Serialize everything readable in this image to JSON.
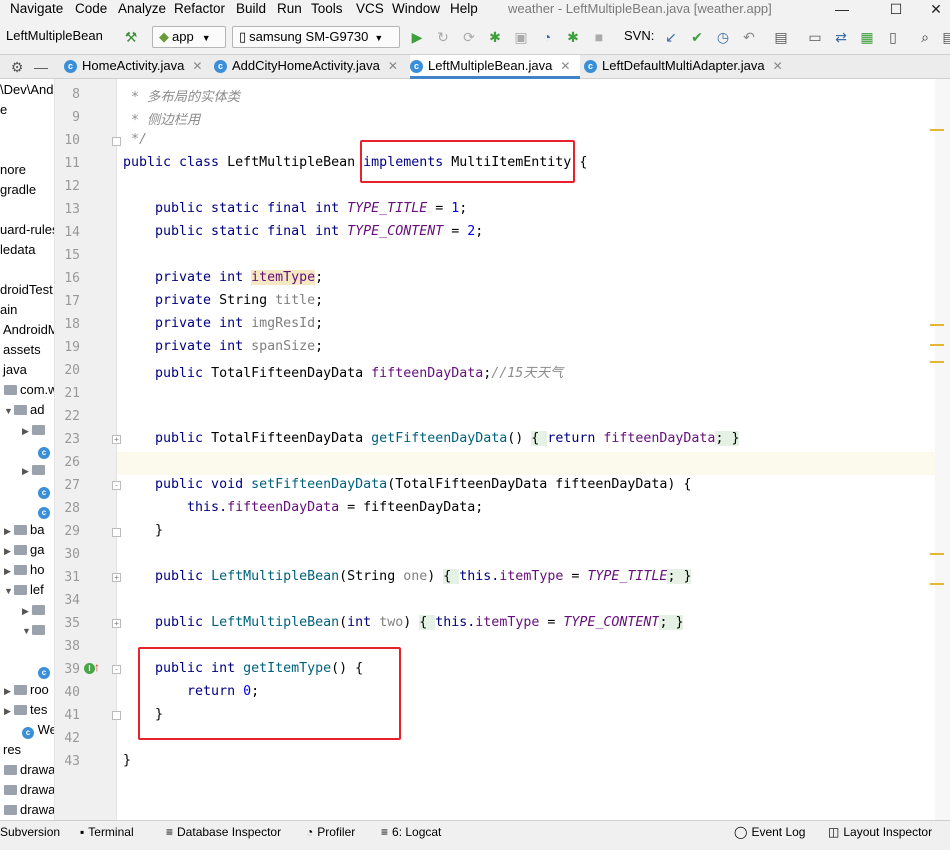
{
  "menu": [
    "Navigate",
    "Code",
    "Analyze",
    "Refactor",
    "Build",
    "Run",
    "Tools",
    "VCS",
    "Window",
    "Help"
  ],
  "window_title": "weather - LeftMultipleBean.java [weather.app]",
  "toolbar": {
    "breadcrumb": "LeftMultipleBean",
    "config": "app",
    "device": "samsung SM-G9730",
    "svn_label": "SVN:"
  },
  "tabs": [
    {
      "label": "HomeActivity.java"
    },
    {
      "label": "AddCityHomeActivity.java"
    },
    {
      "label": "LeftMultipleBean.java"
    },
    {
      "label": "LeftDefaultMultiAdapter.java"
    }
  ],
  "project_tree": [
    "e",
    "\\Dev\\And",
    "e",
    "nore",
    "gradle",
    "uard-rules",
    "ledata",
    "droidTest",
    "ain",
    "AndroidM",
    "assets",
    "java",
    "com.w",
    "ad",
    "ba",
    "ga",
    "ho",
    "lef",
    "roo",
    "tes",
    "We",
    "res",
    "drawa",
    "drawa",
    "drawa"
  ],
  "line_numbers": [
    "8",
    "9",
    "10",
    "11",
    "12",
    "13",
    "14",
    "15",
    "16",
    "17",
    "18",
    "19",
    "20",
    "21",
    "22",
    "23",
    "26",
    "27",
    "28",
    "29",
    "30",
    "31",
    "34",
    "35",
    "38",
    "39",
    "40",
    "41",
    "42",
    "43"
  ],
  "code": {
    "l8": " * 多布局的实体类",
    "l9": " * 侧边栏用",
    "l10": " */",
    "l11a": "public class ",
    "l11b": "LeftMultipleBean ",
    "l11c": "implements ",
    "l11d": "MultiItemEntity ",
    "l11e": "{",
    "l13a": "    public static final int ",
    "l13b": "TYPE_TITLE",
    "l13c": " = ",
    "l13d": "1",
    "l13e": ";",
    "l14a": "    public static final int ",
    "l14b": "TYPE_CONTENT",
    "l14c": " = ",
    "l14d": "2",
    "l14e": ";",
    "l16a": "    private int ",
    "l16b": "itemType",
    "l16c": ";",
    "l17a": "    private ",
    "l17b": "String ",
    "l17c": "title",
    "l17d": ";",
    "l18a": "    private int ",
    "l18b": "imgResId",
    "l18c": ";",
    "l19a": "    private int ",
    "l19b": "spanSize",
    "l19c": ";",
    "l20a": "    public ",
    "l20b": "TotalFifteenDayData ",
    "l20c": "fifteenDayData",
    "l20d": ";",
    "l20e": "//15天天气",
    "l23a": "    public ",
    "l23b": "TotalFifteenDayData ",
    "l23c": "getFifteenDayData",
    "l23d": "() ",
    "l23e": "{ ",
    "l23f": "return ",
    "l23g": "fifteenDayData",
    "l23h": "; ",
    "l23i": "}",
    "l27a": "    public void ",
    "l27b": "setFifteenDayData",
    "l27c": "(TotalFifteenDayData fifteenDayData) {",
    "l28a": "        this.",
    "l28b": "fifteenDayData",
    "l28c": " = fifteenDayData;",
    "l29": "    }",
    "l31a": "    public ",
    "l31b": "LeftMultipleBean",
    "l31c": "(String ",
    "l31d": "one",
    ") ": "",
    "l31e": ") ",
    "l31f": "{ ",
    "l31g": "this.",
    "l31h": "itemType",
    "l31i": " = ",
    "l31j": "TYPE_TITLE",
    "l31k": "; ",
    "l31l": "}",
    "l35a": "    public ",
    "l35b": "LeftMultipleBean",
    "l35c": "(",
    "l35d": "int ",
    "l35e": "two",
    "l35f": ") ",
    "l35g": "{ ",
    "l35h": "this.",
    "l35i": "itemType",
    "l35j": " = ",
    "l35k": "TYPE_CONTENT",
    "l35l": "; ",
    "l35m": "}",
    "l39a": "    public int ",
    "l39b": "getItemType",
    "l39c": "() {",
    "l40a": "        return ",
    "l40b": "0",
    "l40c": ";",
    "l41": "    }",
    "l43": "}"
  },
  "status": {
    "subversion": "Subversion",
    "terminal": "Terminal",
    "database": "Database Inspector",
    "profiler": "Profiler",
    "logcat": "6: Logcat",
    "event_log": "Event Log",
    "layout_inspector": "Layout Inspector"
  }
}
